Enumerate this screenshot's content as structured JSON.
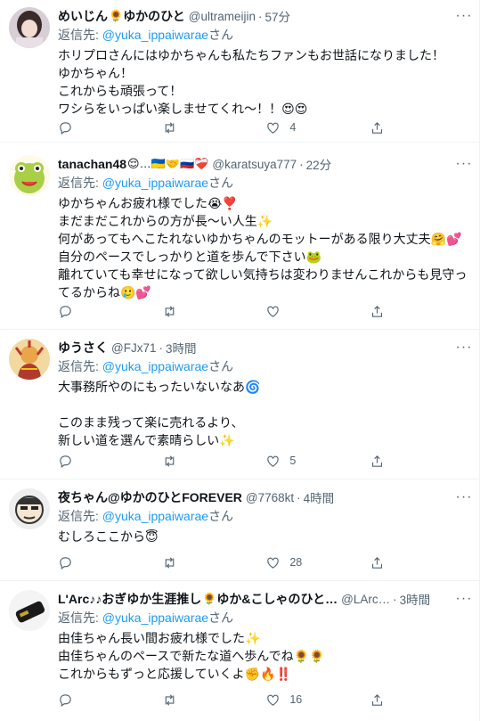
{
  "tweets": [
    {
      "name": "めいじん",
      "name_emoji": "🌻",
      "name_suffix": "ゆかのひと",
      "handle": "@ultrameijin",
      "dot": "·",
      "time": "57分",
      "reply_prefix": "返信先:",
      "reply_to": "@yuka_ippaiwarae",
      "reply_suffix": "さん",
      "lines": [
        "ホリプロさんにはゆかちゃんも私たちファンもお世話になりました！",
        "ゆかちゃん！",
        "これからも頑張って！",
        "ワシらをいっぱい楽しませてくれ〜！！😍😍"
      ],
      "counts": {
        "reply": "",
        "retweet": "",
        "like": "4"
      }
    },
    {
      "name": "tanachan48",
      "name_emoji": "😌…🇺🇦🤝🇷🇺❤️‍🩹",
      "name_suffix": "",
      "handle": "@karatsuya777",
      "dot": "·",
      "time": "22分",
      "reply_prefix": "返信先:",
      "reply_to": "@yuka_ippaiwarae",
      "reply_suffix": "さん",
      "lines": [
        "ゆかちゃんお疲れ様でした😭❣️",
        "まだまだこれからの方が長〜い人生✨",
        "何があってもへこたれないゆかちゃんのモットーがある限り大丈夫🤗💕自分のペースでしっかりと道を歩んで下さい🐸",
        "離れていても幸せになって欲しい気持ちは変わりませんこれからも見守ってるからね🥲💕"
      ],
      "counts": {
        "reply": "",
        "retweet": "",
        "like": ""
      }
    },
    {
      "name": "ゆうさく",
      "name_emoji": "",
      "name_suffix": "",
      "handle": "@FJx71",
      "dot": "·",
      "time": "3時間",
      "reply_prefix": "返信先:",
      "reply_to": "@yuka_ippaiwarae",
      "reply_suffix": "さん",
      "lines": [
        "大事務所やのにもったいないなあ🌀",
        "",
        "このまま残って楽に売れるより、",
        "新しい道を選んで素晴らしい✨"
      ],
      "counts": {
        "reply": "",
        "retweet": "",
        "like": "5"
      }
    },
    {
      "name": "夜ちゃん@ゆかのひとFOREVER",
      "name_emoji": "",
      "name_suffix": "",
      "handle": "@7768kt",
      "dot": "·",
      "time": "4時間",
      "reply_prefix": "返信先:",
      "reply_to": "@yuka_ippaiwarae",
      "reply_suffix": "さん",
      "lines": [
        "むしろここから😇"
      ],
      "counts": {
        "reply": "",
        "retweet": "",
        "like": "28"
      }
    },
    {
      "name": "L'Arc♪♪おぎゆか生涯推し",
      "name_emoji": "🌻",
      "name_suffix": "ゆか&こしゃのひと…",
      "handle": "@LArc…",
      "dot": "·",
      "time": "3時間",
      "reply_prefix": "返信先:",
      "reply_to": "@yuka_ippaiwarae",
      "reply_suffix": "さん",
      "lines": [
        "由佳ちゃん長い間お疲れ様でした✨",
        "由佳ちゃんのペースで新たな道へ歩んでね🌻🌻",
        "これからもずっと応援していくよ✊🔥‼️"
      ],
      "counts": {
        "reply": "",
        "retweet": "",
        "like": "16"
      }
    }
  ],
  "more_glyph": "···",
  "colors": {
    "link": "#1d9bf0",
    "muted": "#536471",
    "text": "#0f1419",
    "divider": "#eff3f4"
  }
}
